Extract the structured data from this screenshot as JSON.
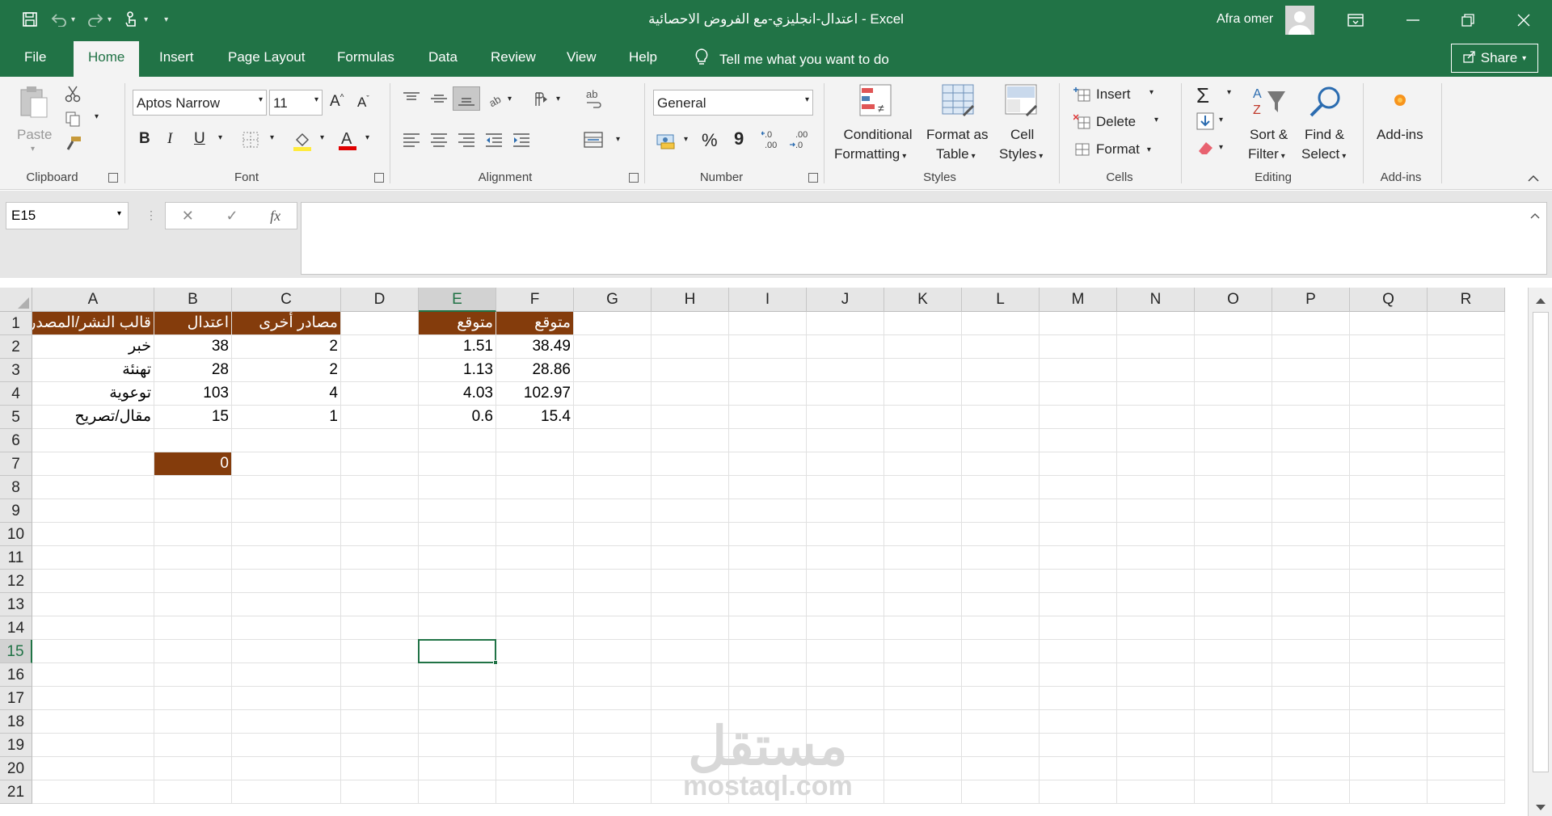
{
  "window": {
    "title": "اعتدال-انجليزي-مع الفروض الاحصائية  -  Excel",
    "user": "Afra omer"
  },
  "menu": {
    "tabs": [
      "File",
      "Home",
      "Insert",
      "Page Layout",
      "Formulas",
      "Data",
      "Review",
      "View",
      "Help"
    ],
    "tell_me": "Tell me what you want to do",
    "share": "Share"
  },
  "ribbon": {
    "clipboard": {
      "paste": "Paste",
      "label": "Clipboard"
    },
    "font": {
      "name": "Aptos Narrow",
      "size": "11",
      "bold": "B",
      "italic": "I",
      "underline": "U",
      "label": "Font"
    },
    "alignment": {
      "label": "Alignment"
    },
    "number": {
      "format": "General",
      "percent": "%",
      "comma": "9",
      "label": "Number"
    },
    "styles": {
      "conditional_1": "Conditional",
      "conditional_2": "Formatting",
      "format_table_1": "Format as",
      "format_table_2": "Table",
      "cell_styles_1": "Cell",
      "cell_styles_2": "Styles",
      "label": "Styles"
    },
    "cells": {
      "insert": "Insert",
      "delete": "Delete",
      "format": "Format",
      "label": "Cells"
    },
    "editing": {
      "sort_1": "Sort &",
      "sort_2": "Filter",
      "find_1": "Find &",
      "find_2": "Select",
      "label": "Editing"
    },
    "addins": {
      "button": "Add-ins",
      "label": "Add-ins"
    }
  },
  "formula_bar": {
    "name_box": "E15",
    "fx": "fx",
    "content": ""
  },
  "sheet": {
    "columns": [
      "A",
      "B",
      "C",
      "D",
      "E",
      "F",
      "G",
      "H",
      "I",
      "J",
      "K",
      "L",
      "M",
      "N",
      "O",
      "P",
      "Q",
      "R"
    ],
    "rows": [
      "1",
      "2",
      "3",
      "4",
      "5",
      "6",
      "7",
      "8",
      "9",
      "10",
      "11",
      "12",
      "13",
      "14",
      "15",
      "16",
      "17",
      "18",
      "19",
      "20",
      "21"
    ],
    "selected_cell": "E15",
    "cells": {
      "A1": "قالب النشر/المصدر",
      "B1": "اعتدال",
      "C1": "مصادر أخرى",
      "E1": "متوقع",
      "F1": "متوقع",
      "A2": "خبر",
      "B2": "38",
      "C2": "2",
      "E2": "1.51",
      "F2": "38.49",
      "A3": "تهنئة",
      "B3": "28",
      "C3": "2",
      "E3": "1.13",
      "F3": "28.86",
      "A4": "توعوية",
      "B4": "103",
      "C4": "4",
      "E4": "4.03",
      "F4": "102.97",
      "A5": "مقال/تصريح",
      "B5": "15",
      "C5": "1",
      "E5": "0.6",
      "F5": "15.4",
      "B7": "0"
    }
  },
  "watermark": {
    "arabic": "مستقل",
    "latin": "mostaql.com"
  },
  "colors": {
    "excel_green": "#217346",
    "header_fill": "#843c0c"
  }
}
